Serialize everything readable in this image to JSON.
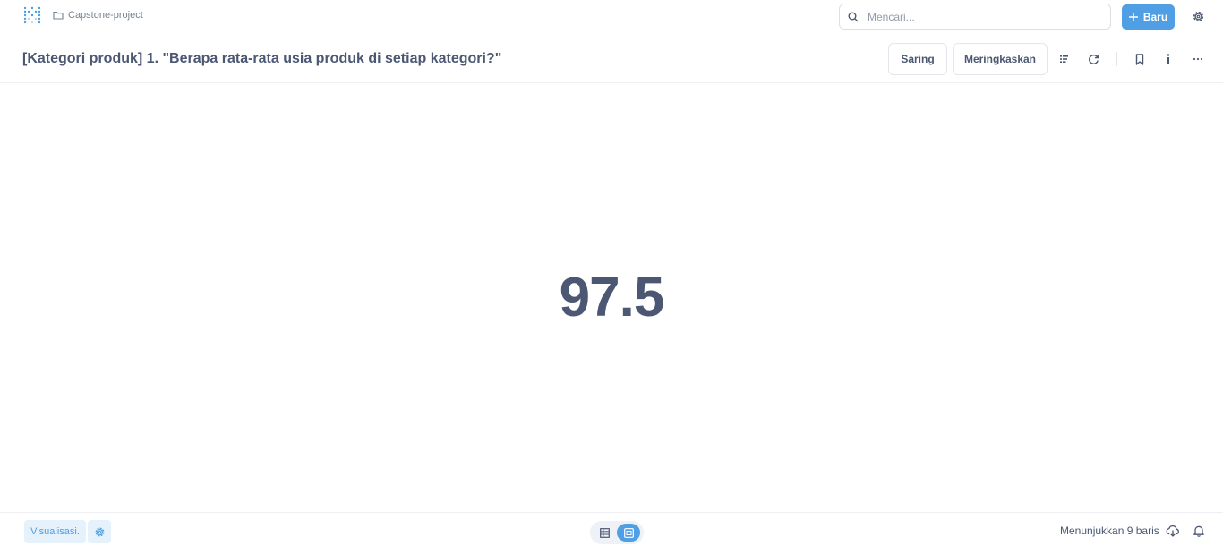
{
  "topnav": {
    "collection_label": "Capstone-project",
    "search_placeholder": "Mencari...",
    "new_button_label": "Baru"
  },
  "header": {
    "title": "[Kategori produk] 1. \"Berapa rata-rata usia produk di setiap kategori?\"",
    "filter_label": "Saring",
    "summarize_label": "Meringkaskan"
  },
  "scalar": {
    "value": "97.5"
  },
  "footer": {
    "visualization_label": "Visualisasi.",
    "row_count_text": "Menunjukkan 9 baris"
  },
  "colors": {
    "brand": "#509ee3",
    "brand_light": "#e5f1fb",
    "text": "#4c5773",
    "muted": "#74838f",
    "border": "#e3e6ea"
  },
  "icons": {
    "logo": "metabase-logo",
    "collection": "folder-icon",
    "search": "search-icon",
    "new": "plus-icon",
    "settings": "gear-icon",
    "notebook": "notebook-icon",
    "refresh": "refresh-icon",
    "bookmark": "bookmark-icon",
    "info": "info-icon",
    "more": "ellipsis-icon",
    "table_view": "table-icon",
    "chart_view": "scalar-icon",
    "download": "cloud-download-icon",
    "alert": "bell-icon"
  }
}
